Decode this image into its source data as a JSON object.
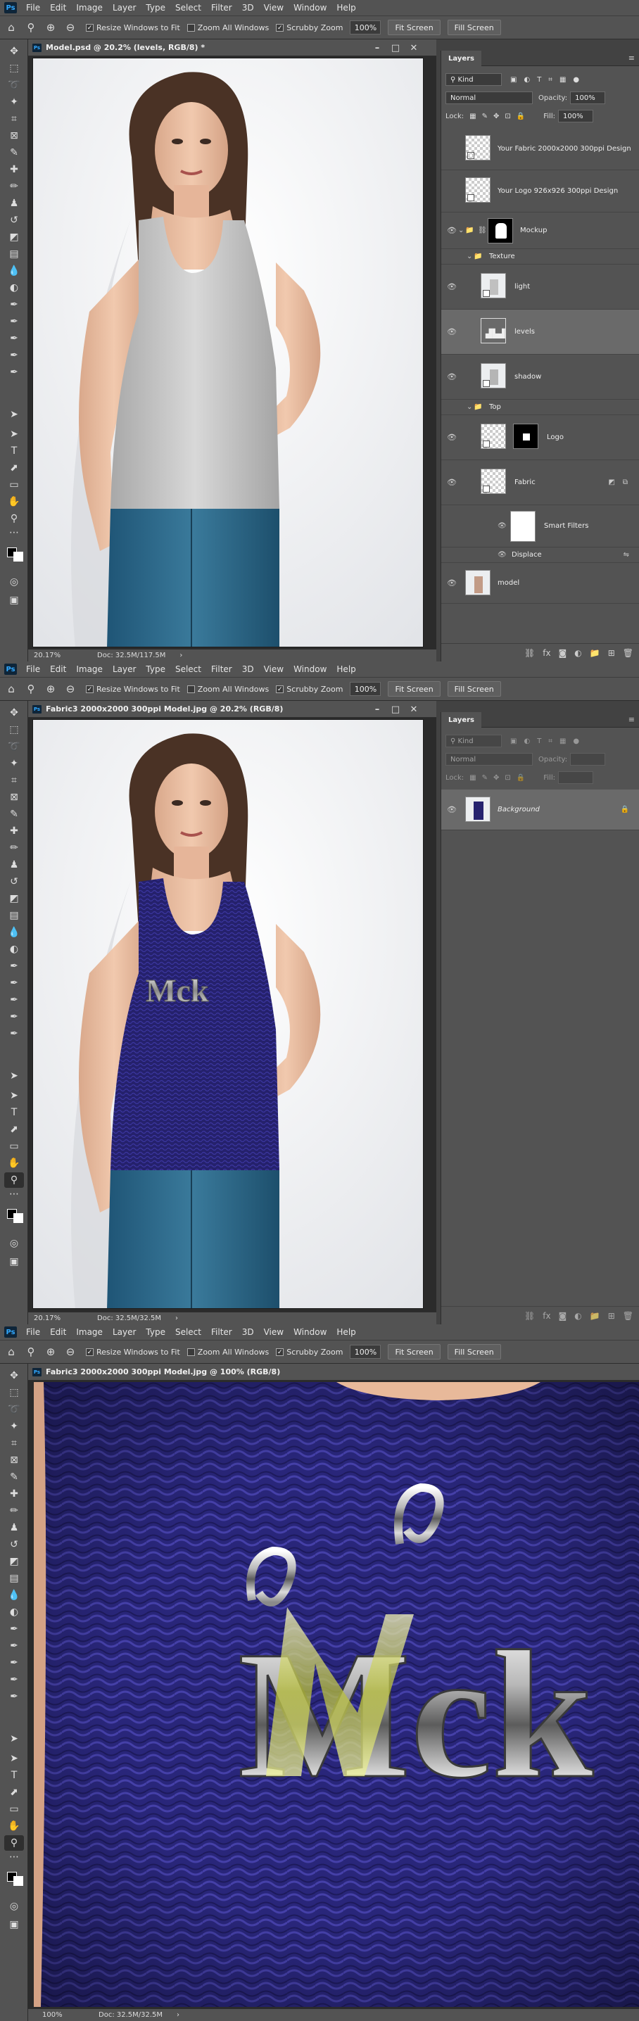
{
  "app": {
    "logo": "Ps"
  },
  "menu": [
    "File",
    "Edit",
    "Image",
    "Layer",
    "Type",
    "Select",
    "Filter",
    "3D",
    "View",
    "Window",
    "Help"
  ],
  "options": {
    "resize_windows": "Resize Windows to Fit",
    "zoom_all": "Zoom All Windows",
    "scrubby": "Scrubby Zoom",
    "zoom_value": "100%",
    "fit_screen": "Fit Screen",
    "fill_screen": "Fill Screen"
  },
  "shot1": {
    "doc_title": "Model.psd @ 20.2% (levels, RGB/8) *",
    "status_zoom": "20.17%",
    "status_doc": "Doc: 32.5M/117.5M",
    "panel_title": "Layers",
    "filter_kind": "Kind",
    "blend_mode": "Normal",
    "opacity_label": "Opacity:",
    "opacity_value": "100%",
    "lock_label": "Lock:",
    "fill_label": "Fill:",
    "fill_value": "100%",
    "layers": [
      {
        "name": "Your Fabric 2000x2000 300ppi Design"
      },
      {
        "name": "Your Logo 926x926 300ppi Design"
      },
      {
        "name": "Mockup"
      },
      {
        "name": "Texture"
      },
      {
        "name": "light"
      },
      {
        "name": "levels"
      },
      {
        "name": "shadow"
      },
      {
        "name": "Top"
      },
      {
        "name": "Logo"
      },
      {
        "name": "Fabric"
      },
      {
        "name": "Smart Filters"
      },
      {
        "name": "Displace"
      },
      {
        "name": "model"
      }
    ]
  },
  "shot2": {
    "doc_title": "Fabric3 2000x2000 300ppi Model.jpg @ 20.2% (RGB/8)",
    "status_zoom": "20.17%",
    "status_doc": "Doc: 32.5M/32.5M",
    "panel_title": "Layers",
    "filter_kind": "Kind",
    "blend_mode": "Normal",
    "opacity_label": "Opacity:",
    "lock_label": "Lock:",
    "fill_label": "Fill:",
    "layer_name": "Background",
    "logo_text": "Mck"
  },
  "shot3": {
    "doc_title": "Fabric3 2000x2000 300ppi Model.jpg @ 100% (RGB/8)",
    "status_zoom": "100%",
    "status_doc": "Doc: 32.5M/32.5M",
    "logo_text": "Mck"
  },
  "colors": {
    "panel": "#535353",
    "app_bg": "#424242",
    "accent_blue": "#31a8ff",
    "shirt_gray": "#c4c4c4",
    "shirt_navy": "#26226e",
    "jeans": "#2f6b8b"
  }
}
